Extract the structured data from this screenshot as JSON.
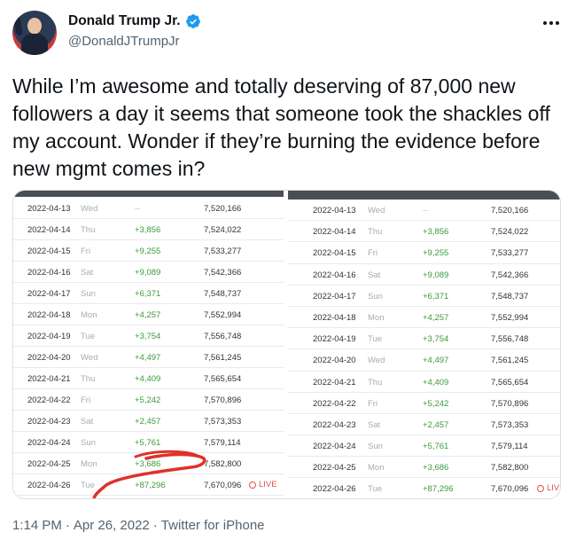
{
  "author": {
    "name": "Donald Trump Jr.",
    "handle": "@DonaldJTrumpJr"
  },
  "tweet": {
    "text": "While I’m awesome and totally deserving of 87,000 new followers a day it seems that someone took the shackles off my account. Wonder if they’re burning the evidence before new mgmt comes in?",
    "time": "1:14 PM",
    "separator": "·",
    "date": "Apr 26, 2022",
    "source": "Twitter for iPhone"
  },
  "media": {
    "live_label": "LIVE",
    "left_rows": [
      {
        "date": "2022-04-13",
        "day": "Wed",
        "delta": "--",
        "total": "7,520,166"
      },
      {
        "date": "2022-04-14",
        "day": "Thu",
        "delta": "+3,856",
        "total": "7,524,022"
      },
      {
        "date": "2022-04-15",
        "day": "Fri",
        "delta": "+9,255",
        "total": "7,533,277"
      },
      {
        "date": "2022-04-16",
        "day": "Sat",
        "delta": "+9,089",
        "total": "7,542,366"
      },
      {
        "date": "2022-04-17",
        "day": "Sun",
        "delta": "+6,371",
        "total": "7,548,737"
      },
      {
        "date": "2022-04-18",
        "day": "Mon",
        "delta": "+4,257",
        "total": "7,552,994"
      },
      {
        "date": "2022-04-19",
        "day": "Tue",
        "delta": "+3,754",
        "total": "7,556,748"
      },
      {
        "date": "2022-04-20",
        "day": "Wed",
        "delta": "+4,497",
        "total": "7,561,245"
      },
      {
        "date": "2022-04-21",
        "day": "Thu",
        "delta": "+4,409",
        "total": "7,565,654"
      },
      {
        "date": "2022-04-22",
        "day": "Fri",
        "delta": "+5,242",
        "total": "7,570,896"
      },
      {
        "date": "2022-04-23",
        "day": "Sat",
        "delta": "+2,457",
        "total": "7,573,353"
      },
      {
        "date": "2022-04-24",
        "day": "Sun",
        "delta": "+5,761",
        "total": "7,579,114"
      },
      {
        "date": "2022-04-25",
        "day": "Mon",
        "delta": "+3,686",
        "total": "7,582,800"
      },
      {
        "date": "2022-04-26",
        "day": "Tue",
        "delta": "+87,296",
        "total": "7,670,096"
      }
    ],
    "right_rows": [
      {
        "date": "2022-04-13",
        "day": "Wed",
        "delta": "--",
        "total": "7,520,166"
      },
      {
        "date": "2022-04-14",
        "day": "Thu",
        "delta": "+3,856",
        "total": "7,524,022"
      },
      {
        "date": "2022-04-15",
        "day": "Fri",
        "delta": "+9,255",
        "total": "7,533,277"
      },
      {
        "date": "2022-04-16",
        "day": "Sat",
        "delta": "+9,089",
        "total": "7,542,366"
      },
      {
        "date": "2022-04-17",
        "day": "Sun",
        "delta": "+6,371",
        "total": "7,548,737"
      },
      {
        "date": "2022-04-18",
        "day": "Mon",
        "delta": "+4,257",
        "total": "7,552,994"
      },
      {
        "date": "2022-04-19",
        "day": "Tue",
        "delta": "+3,754",
        "total": "7,556,748"
      },
      {
        "date": "2022-04-20",
        "day": "Wed",
        "delta": "+4,497",
        "total": "7,561,245"
      },
      {
        "date": "2022-04-21",
        "day": "Thu",
        "delta": "+4,409",
        "total": "7,565,654"
      },
      {
        "date": "2022-04-22",
        "day": "Fri",
        "delta": "+5,242",
        "total": "7,570,896"
      },
      {
        "date": "2022-04-23",
        "day": "Sat",
        "delta": "+2,457",
        "total": "7,573,353"
      },
      {
        "date": "2022-04-24",
        "day": "Sun",
        "delta": "+5,761",
        "total": "7,579,114"
      },
      {
        "date": "2022-04-25",
        "day": "Mon",
        "delta": "+3,686",
        "total": "7,582,800"
      },
      {
        "date": "2022-04-26",
        "day": "Tue",
        "delta": "+87,296",
        "total": "7,670,096"
      }
    ]
  },
  "icons": {
    "verified": "verified-badge-icon",
    "more": "more-options-icon",
    "live": "live-dot-icon"
  },
  "colors": {
    "verified_blue": "#1d9bf0",
    "delta_green": "#3a9b3a",
    "live_red": "#d9534f",
    "scribble_red": "#e0302a"
  }
}
